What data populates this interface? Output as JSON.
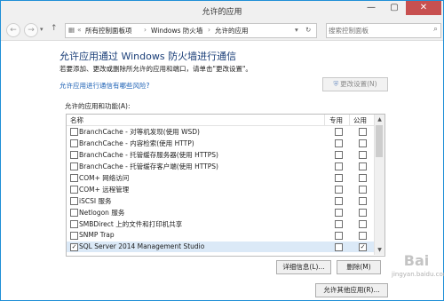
{
  "window": {
    "title": "允许的应用",
    "min_glyph": "—",
    "max_glyph": "▢",
    "close_glyph": "✕"
  },
  "nav": {
    "back_glyph": "←",
    "forward_glyph": "→",
    "dropdown_glyph": "▾",
    "up_glyph": "↑",
    "refresh_glyph": "↻",
    "breadcrumb": {
      "prefix": "«",
      "items": [
        "所有控制面板项",
        "Windows 防火墙",
        "允许的应用"
      ],
      "sep": "›"
    },
    "search_placeholder": "搜索控制面板"
  },
  "content": {
    "heading": "允许应用通过 Windows 防火墙进行通信",
    "subtext": "若要添加、更改或删除所允许的应用和端口，请单击\"更改设置\"。",
    "risk_link": "允许应用进行通信有哪些风险?",
    "change_settings": "更改设置(N)",
    "group_label": "允许的应用和功能(A):",
    "col_name": "名称",
    "col_private": "专用",
    "col_public": "公用",
    "rows": [
      {
        "name": "BranchCache - 对等机发现(使用 WSD)",
        "checked": false,
        "private": false,
        "public": false
      },
      {
        "name": "BranchCache - 内容检索(使用 HTTP)",
        "checked": false,
        "private": false,
        "public": false
      },
      {
        "name": "BranchCache - 托管缓存服务器(使用 HTTPS)",
        "checked": false,
        "private": false,
        "public": false
      },
      {
        "name": "BranchCache - 托管缓存客户端(使用 HTTPS)",
        "checked": false,
        "private": false,
        "public": false
      },
      {
        "name": "COM+ 网络访问",
        "checked": false,
        "private": false,
        "public": false
      },
      {
        "name": "COM+ 远程管理",
        "checked": false,
        "private": false,
        "public": false
      },
      {
        "name": "iSCSI 服务",
        "checked": false,
        "private": false,
        "public": false
      },
      {
        "name": "Netlogon 服务",
        "checked": false,
        "private": false,
        "public": false
      },
      {
        "name": "SMBDirect 上的文件和打印机共享",
        "checked": false,
        "private": false,
        "public": false
      },
      {
        "name": "SNMP Trap",
        "checked": false,
        "private": false,
        "public": false
      },
      {
        "name": "SQL Server 2014 Management Studio",
        "checked": true,
        "private": false,
        "public": true
      }
    ],
    "details_button": "详细信息(L)...",
    "remove_button": "删除(M)",
    "allow_other_button": "允许其他应用(R)..."
  },
  "watermark": {
    "logo": "Bai",
    "text": "jingyan.baidu.com"
  },
  "colors": {
    "close_bg": "#c75050",
    "heading": "#1a3e78",
    "link": "#1a5fb4",
    "border": "#1f8fd6"
  }
}
